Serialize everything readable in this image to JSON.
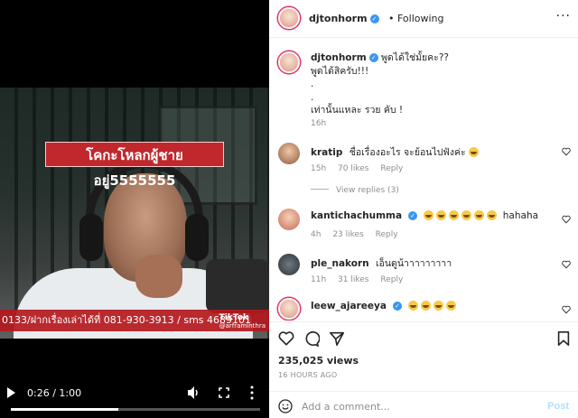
{
  "video": {
    "caption": "โคกะโหลกผู้ชายอยู่5555555",
    "ticker": "0133/ฝากเรื่องเล่าได้ที่ 081-930-3913 / sms 4689101",
    "tiktok_label": "TikTok",
    "tiktok_handle": "@arframinthra",
    "time": "0:26 / 1:00",
    "progress": 0.43
  },
  "header": {
    "username": "djtonhorm",
    "follow_text": "Following",
    "separator": "•",
    "more": "···"
  },
  "caption": {
    "username": "djtonhorm",
    "line1": "พูดได้ใช่มั้ยคะ??",
    "line2": "พูดได้สิครับ!!!",
    "line3": ".",
    "line4": ".",
    "line5": "เท่านั้นแหละ รวย คับ !",
    "time": "16h"
  },
  "comments": [
    {
      "username": "kratip",
      "text": "ชื่อเรื่องอะไร จะย้อนไปฟังค่ะ",
      "emoji_count": 1,
      "suffix": "",
      "time": "15h",
      "likes": "70 likes",
      "reply": "Reply",
      "view_replies": "View replies (3)"
    },
    {
      "username": "kantichachumma",
      "text": "",
      "emoji_count": 6,
      "suffix": "hahaha",
      "time": "4h",
      "likes": "23 likes",
      "reply": "Reply"
    },
    {
      "username": "ple_nakorn",
      "text": "เอ็นดูน้าาาาาาาาา",
      "emoji_count": 0,
      "suffix": "",
      "time": "11h",
      "likes": "31 likes",
      "reply": "Reply"
    },
    {
      "username": "leew_ajareeya",
      "text": "",
      "emoji_count": 4,
      "suffix": "",
      "time": "",
      "likes": "",
      "reply": ""
    }
  ],
  "actions": {
    "icons": [
      "heart-icon",
      "comment-icon",
      "share-icon",
      "bookmark-icon"
    ]
  },
  "stats": {
    "views": "235,025 views",
    "ago": "16 HOURS AGO"
  },
  "add_comment": {
    "placeholder": "Add a comment...",
    "post_label": "Post"
  },
  "colors": {
    "verified": "#3897f0",
    "post_disabled": "#b2dffc",
    "caption_bg": "#c0282d"
  }
}
